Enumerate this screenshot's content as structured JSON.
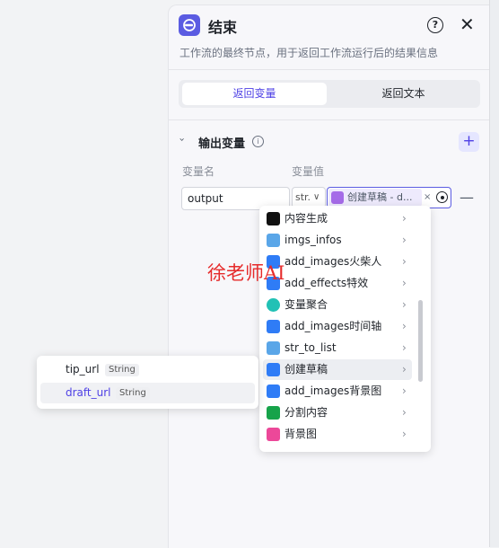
{
  "header": {
    "icon": "end-node-icon",
    "title": "结束",
    "description": "工作流的最终节点，用于返回工作流运行后的结果信息"
  },
  "tabs": [
    {
      "label": "返回变量",
      "active": true
    },
    {
      "label": "返回文本",
      "active": false
    }
  ],
  "output_section": {
    "title": "输出变量",
    "col_name": "变量名",
    "col_value": "变量值",
    "rows": [
      {
        "name": "output",
        "type": "str.",
        "ref_label": "创建草稿 - d..."
      }
    ]
  },
  "dropdown": {
    "items": [
      {
        "label": "内容生成",
        "icon": "content-gen-icon",
        "color": "#111111"
      },
      {
        "label": "imgs_infos",
        "icon": "code-globe-icon",
        "color": "#5aa6e8"
      },
      {
        "label": "add_images火柴人",
        "icon": "plugin-play-icon",
        "color": "#2f7cf6"
      },
      {
        "label": "add_effects特效",
        "icon": "plugin-play-icon",
        "color": "#2f7cf6"
      },
      {
        "label": "变量聚合",
        "icon": "variable-merge-icon",
        "color": "#22c1b5"
      },
      {
        "label": "add_images时间轴",
        "icon": "plugin-play-icon",
        "color": "#2f7cf6"
      },
      {
        "label": "str_to_list",
        "icon": "code-globe-icon",
        "color": "#5aa6e8"
      },
      {
        "label": "创建草稿",
        "icon": "plugin-play-icon",
        "color": "#2f7cf6"
      },
      {
        "label": "add_images背景图",
        "icon": "plugin-play-icon",
        "color": "#2f7cf6"
      },
      {
        "label": "分割内容",
        "icon": "code-split-icon",
        "color": "#16a34a"
      },
      {
        "label": "背景图",
        "icon": "image-gen-icon",
        "color": "#ec4899"
      }
    ]
  },
  "sub_popup": {
    "items": [
      {
        "label": "tip_url",
        "type": "String"
      },
      {
        "label": "draft_url",
        "type": "String"
      }
    ]
  },
  "watermark": "徐老师AI",
  "colors": {
    "accent": "#4e40e5",
    "node_icon": "#5b5ce2"
  }
}
